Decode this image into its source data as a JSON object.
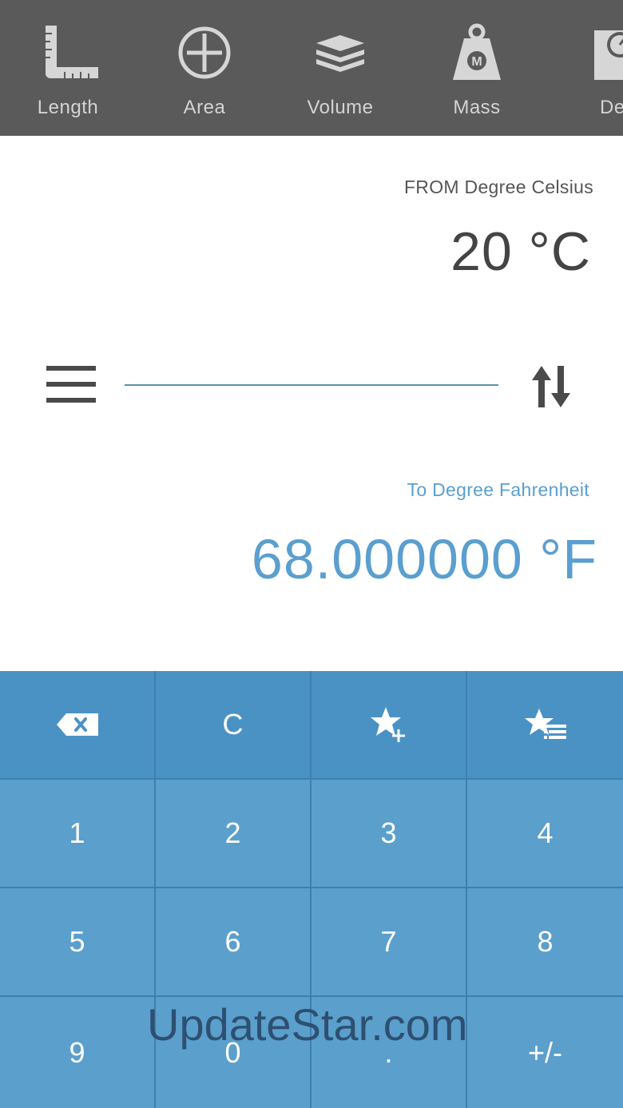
{
  "categories": [
    {
      "label": "Length",
      "icon": "ruler-icon"
    },
    {
      "label": "Area",
      "icon": "area-icon"
    },
    {
      "label": "Volume",
      "icon": "volume-box-icon"
    },
    {
      "label": "Mass",
      "icon": "mass-weight-icon"
    },
    {
      "label": "Dens",
      "icon": "density-scale-icon"
    }
  ],
  "conversion": {
    "from_label": "FROM Degree Celsius",
    "from_value": "20 °C",
    "to_label": "To Degree Fahrenheit",
    "to_value": "68.000000 °F"
  },
  "keypad": {
    "clear_label": "C",
    "keys": [
      "1",
      "2",
      "3",
      "4",
      "5",
      "6",
      "7",
      "8",
      "9",
      "0",
      ".",
      "+/-"
    ],
    "backspace_icon": "backspace-icon",
    "add_favorite_icon": "star-plus-icon",
    "favorites_list_icon": "star-list-icon"
  },
  "watermark": "UpdateStar.com",
  "colors": {
    "topbar": "#5a5a5a",
    "accent": "#5a9fcf",
    "keypad_key": "#5b9fcc",
    "keypad_top_key": "#4a92c4",
    "keypad_grid": "#3f7fae"
  }
}
